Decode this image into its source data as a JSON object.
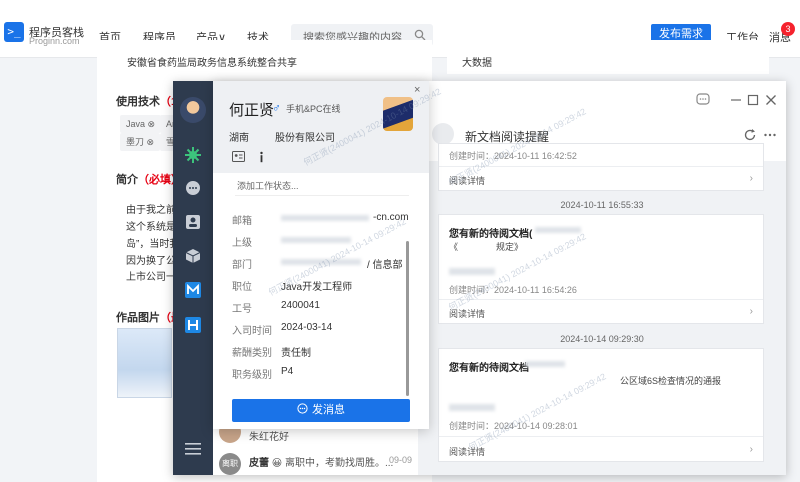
{
  "site": {
    "logo_title": "程序员客栈",
    "logo_sub": "Proginn.com"
  },
  "nav": {
    "home": "首页",
    "programmers": "程序员",
    "products": "产品∨",
    "tech": "技术"
  },
  "search": {
    "placeholder": "搜索您感兴趣的内容"
  },
  "header": {
    "publish": "发布需求",
    "workbench": "工作台",
    "messages": "消息",
    "badge": "3"
  },
  "background": {
    "top_text": "安徽省食药监局政务信息系统整合共享",
    "top_right": "大数据",
    "skills_label": "使用技术",
    "skills_req": "（1-",
    "tags": [
      "Java ⊗",
      "Ar",
      "墨刀 ⊗",
      "雪"
    ],
    "intro_label": "简介",
    "intro_req": "（必填）",
    "intro_lines": [
      "由于我之前在",
      "这个系统是",
      "岛”，当时我",
      "因为换了公司",
      "上市公司一起"
    ],
    "works_label": "作品图片",
    "works_req": "（最低"
  },
  "chats": [
    {
      "preview": "朱红花好"
    },
    {
      "avatar": "离职",
      "name": "皮蕾",
      "preview": "😀 离职中，考勤找周胜。...",
      "date": "09-09"
    }
  ],
  "conversation": {
    "title": "新文档阅读提醒",
    "msg1": {
      "time": "创建时间：2024-10-11 16:42:52",
      "link": "阅读详情",
      "arrow": "›"
    },
    "sep1": "2024-10-11 16:55:33",
    "msg2": {
      "title": "您有新的待阅文档(",
      "line": "《",
      "line_end": "规定》",
      "time": "创建时间：2024-10-11 16:54:26",
      "link": "阅读详情",
      "arrow": "›"
    },
    "sep2": "2024-10-14 09:29:30",
    "msg3": {
      "title": "您有新的待阅文档",
      "line": "公区域6S检查情况的通报",
      "time": "创建时间：2024-10-14 09:28:01",
      "link": "阅读详情",
      "arrow": "›"
    }
  },
  "profile": {
    "name": "何正贤",
    "gender": "♂",
    "online": "手机&PC在线",
    "company_prefix": "湖南",
    "company_suffix": "股份有限公司",
    "status_placeholder": "添加工作状态...",
    "rows": [
      {
        "label": "邮箱",
        "value": "-cn.com"
      },
      {
        "label": "上级",
        "value": ""
      },
      {
        "label": "部门",
        "value": "/ 信息部"
      },
      {
        "label": "职位",
        "value": "Java开发工程师"
      },
      {
        "label": "工号",
        "value": "2400041"
      },
      {
        "label": "入司时间",
        "value": "2024-03-14"
      },
      {
        "label": "薪酬类别",
        "value": "责任制"
      },
      {
        "label": "职务级别",
        "value": "P4"
      }
    ],
    "send": "发消息",
    "close": "×"
  },
  "watermark": "何正贤(2400041) 2024-10-14 09:29:42"
}
